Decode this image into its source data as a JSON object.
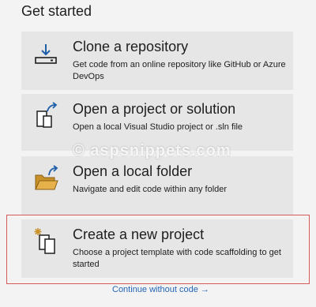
{
  "heading": "Get started",
  "cards": [
    {
      "title": "Clone a repository",
      "desc": "Get code from an online repository like GitHub or Azure DevOps",
      "icon": "clone-download-icon"
    },
    {
      "title": "Open a project or solution",
      "desc": "Open a local Visual Studio project or .sln file",
      "icon": "open-project-icon"
    },
    {
      "title": "Open a local folder",
      "desc": "Navigate and edit code within any folder",
      "icon": "open-folder-icon"
    },
    {
      "title": "Create a new project",
      "desc": "Choose a project template with code scaffolding to get started",
      "icon": "new-project-icon"
    }
  ],
  "continue_link": "Continue without code →",
  "watermark": "© aspsnippets.com",
  "colors": {
    "accent": "#2566b8",
    "highlight": "#d65a5a",
    "icon_blue": "#1f5fa8",
    "folder": "#c8922a"
  }
}
